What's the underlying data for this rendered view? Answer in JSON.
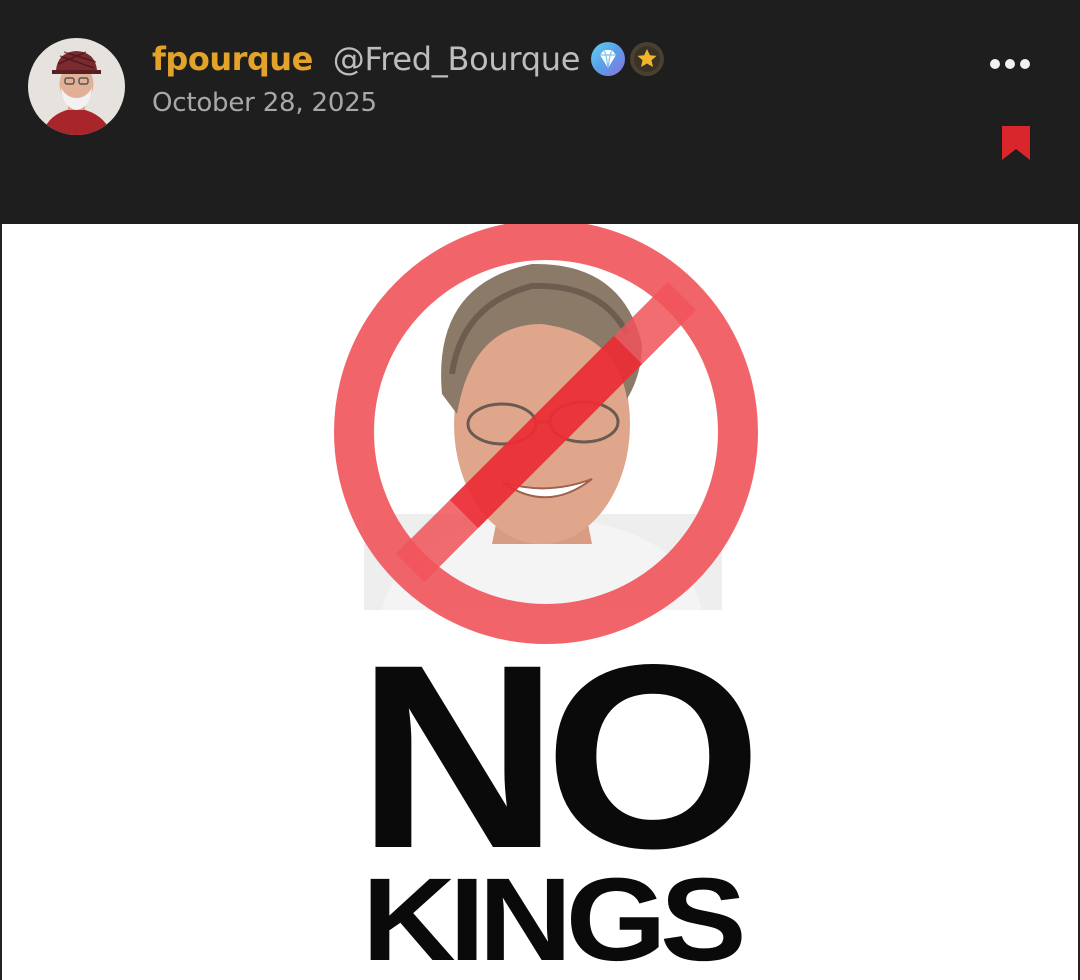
{
  "post": {
    "author": {
      "display_name": "fpourque",
      "handle": "@Fred_Bourque",
      "avatar_icon": "user-avatar-photo",
      "badges": [
        {
          "icon": "diamond-badge-icon",
          "color": "#5ab0e8"
        },
        {
          "icon": "star-badge-icon",
          "color": "#e3a32a"
        }
      ]
    },
    "date": "October 28, 2025",
    "actions": {
      "more_icon": "more-horizontal-icon",
      "bookmark_icon": "bookmark-icon",
      "bookmark_color": "#d9262b"
    },
    "image": {
      "line1": "NO",
      "line2": "KINGS",
      "prohibition_color": "#f0545a"
    }
  },
  "colors": {
    "header_bg": "#1e1e1e",
    "name": "#e3a32a",
    "handle": "#bdbdbd",
    "date": "#a8a8a8"
  }
}
